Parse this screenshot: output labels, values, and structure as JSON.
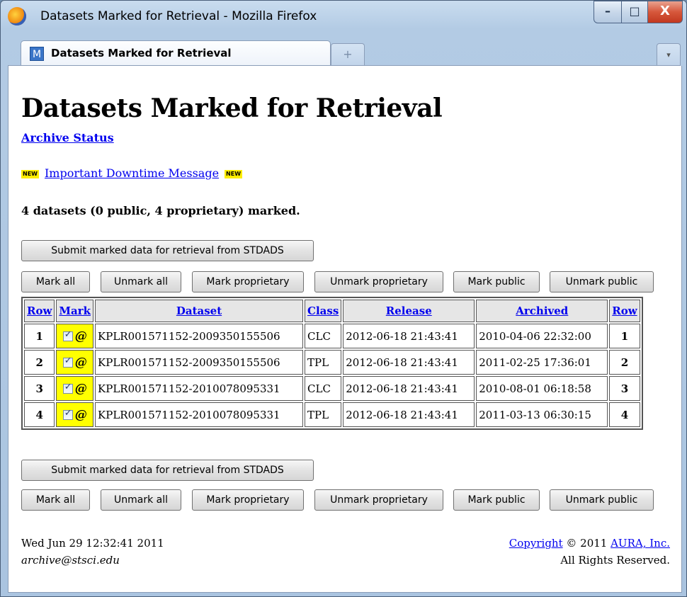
{
  "window": {
    "title": "Datasets Marked for Retrieval - Mozilla Firefox",
    "controls": {
      "minimize": "–",
      "maximize": "□",
      "close": "X"
    }
  },
  "browser": {
    "tab_label": "Datasets Marked for Retrieval",
    "tab_favicon": "M",
    "new_tab": "+",
    "tab_list": "▾"
  },
  "page": {
    "heading": "Datasets Marked for Retrieval",
    "archive_status_link": "Archive Status",
    "new_badge": "NEW",
    "downtime_link": "Important Downtime Message",
    "summary": "4 datasets (0 public, 4 proprietary) marked."
  },
  "buttons": {
    "submit": "Submit marked data for retrieval from STDADS",
    "mark_all": "Mark all",
    "unmark_all": "Unmark all",
    "mark_proprietary": "Mark proprietary",
    "unmark_proprietary": "Unmark proprietary",
    "mark_public": "Mark public",
    "unmark_public": "Unmark public"
  },
  "table": {
    "headers": {
      "row": "Row",
      "mark": "Mark",
      "dataset": "Dataset",
      "class": "Class",
      "release": "Release",
      "archived": "Archived",
      "row_end": "Row"
    },
    "mark_symbol": "@",
    "rows": [
      {
        "row": "1",
        "dataset": "KPLR001571152-2009350155506",
        "class": "CLC",
        "release": "2012-06-18 21:43:41",
        "archived": "2010-04-06 22:32:00",
        "checked": true
      },
      {
        "row": "2",
        "dataset": "KPLR001571152-2009350155506",
        "class": "TPL",
        "release": "2012-06-18 21:43:41",
        "archived": "2011-02-25 17:36:01",
        "checked": true
      },
      {
        "row": "3",
        "dataset": "KPLR001571152-2010078095331",
        "class": "CLC",
        "release": "2012-06-18 21:43:41",
        "archived": "2010-08-01 06:18:58",
        "checked": true
      },
      {
        "row": "4",
        "dataset": "KPLR001571152-2010078095331",
        "class": "TPL",
        "release": "2012-06-18 21:43:41",
        "archived": "2011-03-13 06:30:15",
        "checked": true
      }
    ]
  },
  "footer": {
    "date": "Wed Jun 29 12:32:41 2011",
    "email": "archive@stsci.edu",
    "copyright_link": "Copyright",
    "copyright_text": " © 2011 ",
    "aura_link": "AURA, Inc.",
    "rights": "All Rights Reserved."
  }
}
